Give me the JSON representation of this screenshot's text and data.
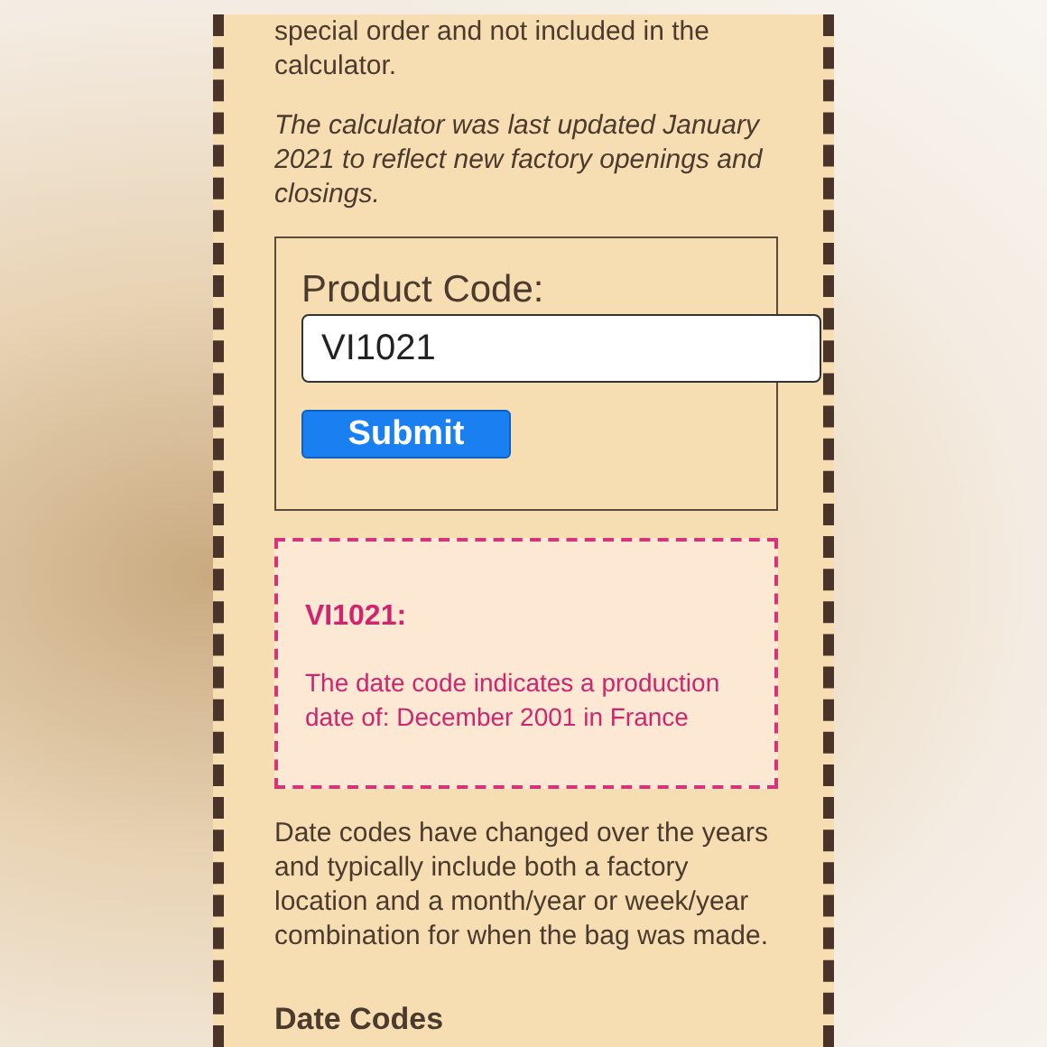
{
  "intro_text": "special order and not included in the calculator.",
  "update_note": "The calculator was last updated January 2021 to reflect new factory openings and closings.",
  "form": {
    "label": "Product Code:",
    "value": "VI1021",
    "submit": "Submit"
  },
  "result": {
    "title": "VI1021:",
    "message": "The date code indicates a production date of: December 2001 in France"
  },
  "explanation": "Date codes have changed over the years and typically include both a factory location and a month/year or week/year combination for when the bag was made.",
  "heading": "Date Codes"
}
